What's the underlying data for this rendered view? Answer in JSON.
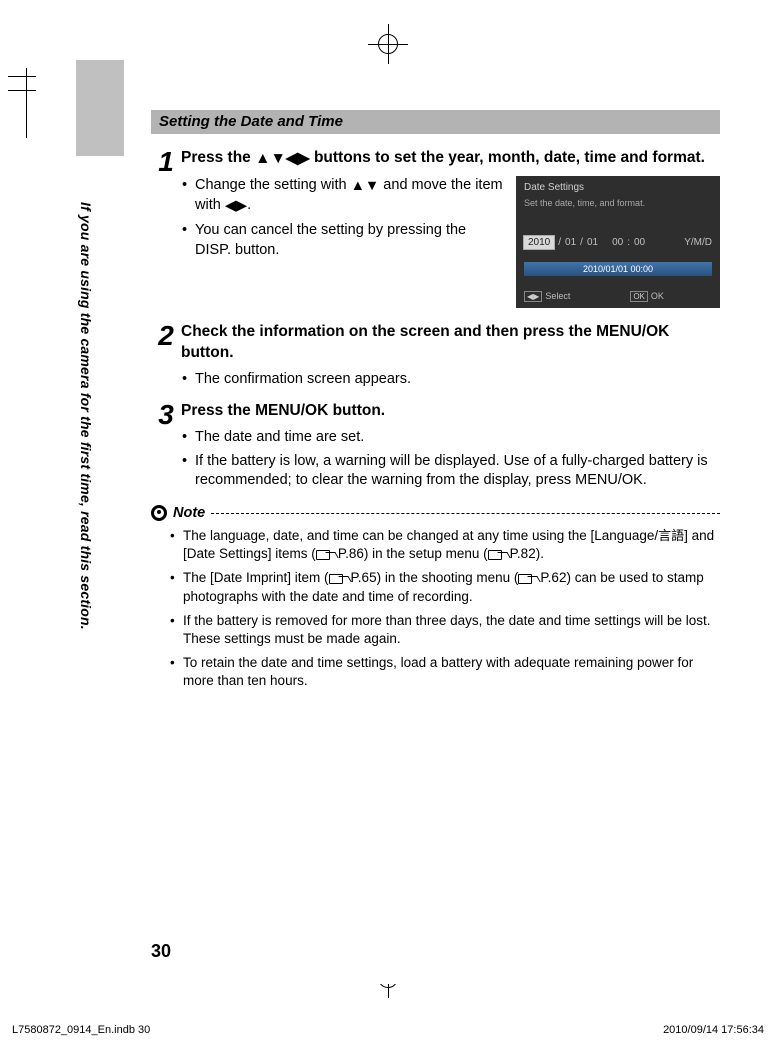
{
  "section_title": "Setting the Date and Time",
  "vertical_label": "If you are using the camera for the first time, read this section.",
  "steps": [
    {
      "num": "1",
      "title_before": "Press the ",
      "title_after": " buttons to set the year, month, date, time and format.",
      "bullets": [
        {
          "before": "Change the setting with ",
          "mid": " and move the item with ",
          "after": "."
        },
        {
          "text": "You can cancel the setting by pressing the DISP. button."
        }
      ]
    },
    {
      "num": "2",
      "title": "Check the information on the screen and then press the MENU/OK button.",
      "bullets": [
        {
          "text": "The confirmation screen appears."
        }
      ]
    },
    {
      "num": "3",
      "title": "Press the MENU/OK button.",
      "bullets": [
        {
          "text": "The date and time are set."
        },
        {
          "text": "If the battery is low, a warning will be displayed. Use of a fully-charged battery is recommended; to clear the warning from the display, press MENU/OK."
        }
      ]
    }
  ],
  "note_label": "Note",
  "notes": [
    {
      "a": "The language, date, and time can be changed at any time using the [Language/",
      "cjk": "言語",
      "b": "] and [Date Settings] items (",
      "p1": "P.86",
      "c": ") in the setup menu (",
      "p2": "P.82",
      "d": ")."
    },
    {
      "a": "The [Date Imprint] item (",
      "p1": "P.65",
      "b": ") in the shooting menu (",
      "p2": "P.62",
      "c": ") can be used to stamp photographs with the date and time of recording."
    },
    {
      "a": "If the battery is removed for more than three days, the date and time settings will be lost. These settings must be made again."
    },
    {
      "a": "To retain the date and time settings, load a battery with adequate remaining power for more than ten hours."
    }
  ],
  "screenshot": {
    "title": "Date Settings",
    "sub": "Set the date, time, and format.",
    "year": "2010",
    "m": "01",
    "d": "01",
    "hh": "00",
    "mm": "00",
    "fmt": "Y/M/D",
    "bar": "2010/01/01  00:00",
    "sel": "Select",
    "ok": "OK"
  },
  "page_number": "30",
  "footer_left": "L7580872_0914_En.indb   30",
  "footer_right": "2010/09/14   17:56:34"
}
